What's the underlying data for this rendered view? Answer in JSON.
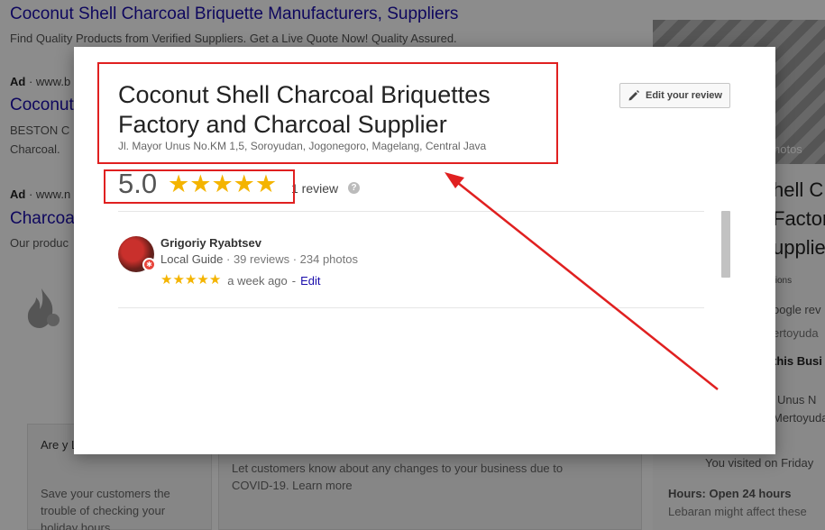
{
  "background": {
    "results": [
      {
        "title": "Coconut Shell Charcoal Briquette Manufacturers, Suppliers",
        "snippet": "Find Quality Products from Verified Suppliers. Get a Live Quote Now! Quality Assured."
      },
      {
        "ad_prefix": "Ad",
        "url": "www.b",
        "title": "Coconut",
        "line1": "BESTON C",
        "line2": "Charcoal."
      },
      {
        "ad_prefix": "Ad",
        "url": "www.n",
        "title": "Charcoa",
        "line1": "Our produc"
      }
    ],
    "right_panel": {
      "photos_label": "hotos",
      "title_lines": [
        "hell C",
        "Factor",
        "upplie"
      ],
      "lines": [
        "tions",
        "oogle rev",
        "ertoyuda",
        "this Busi",
        "Unus N",
        "Mertoyuda"
      ],
      "visited": "You visited on Friday",
      "hours": "Hours: Open 24 hours",
      "lebaran": "Lebaran might affect these"
    },
    "bottom_cards": {
      "card1_title": "Are y Lebaran?",
      "card1_text": "Save your customers the trouble of checking your holiday hours",
      "card2_text": "Let customers know about any changes to your business due to COVID-19. Learn more"
    }
  },
  "modal": {
    "business_name": "Coconut Shell Charcoal Briquettes Factory and Charcoal Supplier",
    "address": "Jl. Mayor Unus No.KM 1,5, Soroyudan, Jogonegoro, Magelang, Central Java",
    "edit_review_label": "Edit your review",
    "rating_value": "5.0",
    "rating_stars": 5,
    "review_count": "1 review",
    "help_icon_label": "?",
    "review": {
      "reviewer_name": "Grigoriy Ryabtsev",
      "guide_label": "Local Guide",
      "meta": "· 39 reviews · 234 photos",
      "stars": 5,
      "time": "a week ago",
      "separator": "-",
      "edit_label": "Edit"
    }
  },
  "colors": {
    "star": "#f4b400",
    "annotation": "#e02020",
    "link": "#1a0dab"
  },
  "icons": [
    "pencil-icon",
    "help-icon",
    "star-icon",
    "avatar",
    "local-guide-badge-icon",
    "flame-icon"
  ]
}
